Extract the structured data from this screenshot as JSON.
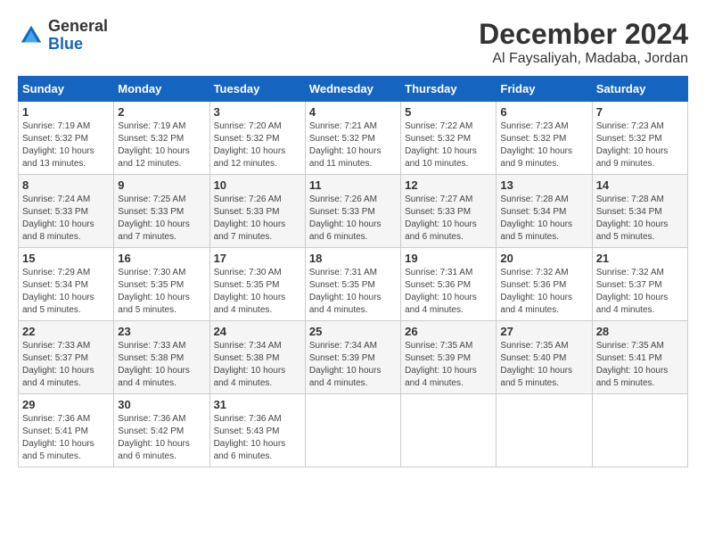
{
  "header": {
    "logo_general": "General",
    "logo_blue": "Blue",
    "month_title": "December 2024",
    "location": "Al Faysaliyah, Madaba, Jordan"
  },
  "days_of_week": [
    "Sunday",
    "Monday",
    "Tuesday",
    "Wednesday",
    "Thursday",
    "Friday",
    "Saturday"
  ],
  "weeks": [
    [
      {
        "day": "1",
        "info": "Sunrise: 7:19 AM\nSunset: 5:32 PM\nDaylight: 10 hours and 13 minutes."
      },
      {
        "day": "2",
        "info": "Sunrise: 7:19 AM\nSunset: 5:32 PM\nDaylight: 10 hours and 12 minutes."
      },
      {
        "day": "3",
        "info": "Sunrise: 7:20 AM\nSunset: 5:32 PM\nDaylight: 10 hours and 12 minutes."
      },
      {
        "day": "4",
        "info": "Sunrise: 7:21 AM\nSunset: 5:32 PM\nDaylight: 10 hours and 11 minutes."
      },
      {
        "day": "5",
        "info": "Sunrise: 7:22 AM\nSunset: 5:32 PM\nDaylight: 10 hours and 10 minutes."
      },
      {
        "day": "6",
        "info": "Sunrise: 7:23 AM\nSunset: 5:32 PM\nDaylight: 10 hours and 9 minutes."
      },
      {
        "day": "7",
        "info": "Sunrise: 7:23 AM\nSunset: 5:32 PM\nDaylight: 10 hours and 9 minutes."
      }
    ],
    [
      {
        "day": "8",
        "info": "Sunrise: 7:24 AM\nSunset: 5:33 PM\nDaylight: 10 hours and 8 minutes."
      },
      {
        "day": "9",
        "info": "Sunrise: 7:25 AM\nSunset: 5:33 PM\nDaylight: 10 hours and 7 minutes."
      },
      {
        "day": "10",
        "info": "Sunrise: 7:26 AM\nSunset: 5:33 PM\nDaylight: 10 hours and 7 minutes."
      },
      {
        "day": "11",
        "info": "Sunrise: 7:26 AM\nSunset: 5:33 PM\nDaylight: 10 hours and 6 minutes."
      },
      {
        "day": "12",
        "info": "Sunrise: 7:27 AM\nSunset: 5:33 PM\nDaylight: 10 hours and 6 minutes."
      },
      {
        "day": "13",
        "info": "Sunrise: 7:28 AM\nSunset: 5:34 PM\nDaylight: 10 hours and 5 minutes."
      },
      {
        "day": "14",
        "info": "Sunrise: 7:28 AM\nSunset: 5:34 PM\nDaylight: 10 hours and 5 minutes."
      }
    ],
    [
      {
        "day": "15",
        "info": "Sunrise: 7:29 AM\nSunset: 5:34 PM\nDaylight: 10 hours and 5 minutes."
      },
      {
        "day": "16",
        "info": "Sunrise: 7:30 AM\nSunset: 5:35 PM\nDaylight: 10 hours and 5 minutes."
      },
      {
        "day": "17",
        "info": "Sunrise: 7:30 AM\nSunset: 5:35 PM\nDaylight: 10 hours and 4 minutes."
      },
      {
        "day": "18",
        "info": "Sunrise: 7:31 AM\nSunset: 5:35 PM\nDaylight: 10 hours and 4 minutes."
      },
      {
        "day": "19",
        "info": "Sunrise: 7:31 AM\nSunset: 5:36 PM\nDaylight: 10 hours and 4 minutes."
      },
      {
        "day": "20",
        "info": "Sunrise: 7:32 AM\nSunset: 5:36 PM\nDaylight: 10 hours and 4 minutes."
      },
      {
        "day": "21",
        "info": "Sunrise: 7:32 AM\nSunset: 5:37 PM\nDaylight: 10 hours and 4 minutes."
      }
    ],
    [
      {
        "day": "22",
        "info": "Sunrise: 7:33 AM\nSunset: 5:37 PM\nDaylight: 10 hours and 4 minutes."
      },
      {
        "day": "23",
        "info": "Sunrise: 7:33 AM\nSunset: 5:38 PM\nDaylight: 10 hours and 4 minutes."
      },
      {
        "day": "24",
        "info": "Sunrise: 7:34 AM\nSunset: 5:38 PM\nDaylight: 10 hours and 4 minutes."
      },
      {
        "day": "25",
        "info": "Sunrise: 7:34 AM\nSunset: 5:39 PM\nDaylight: 10 hours and 4 minutes."
      },
      {
        "day": "26",
        "info": "Sunrise: 7:35 AM\nSunset: 5:39 PM\nDaylight: 10 hours and 4 minutes."
      },
      {
        "day": "27",
        "info": "Sunrise: 7:35 AM\nSunset: 5:40 PM\nDaylight: 10 hours and 5 minutes."
      },
      {
        "day": "28",
        "info": "Sunrise: 7:35 AM\nSunset: 5:41 PM\nDaylight: 10 hours and 5 minutes."
      }
    ],
    [
      {
        "day": "29",
        "info": "Sunrise: 7:36 AM\nSunset: 5:41 PM\nDaylight: 10 hours and 5 minutes."
      },
      {
        "day": "30",
        "info": "Sunrise: 7:36 AM\nSunset: 5:42 PM\nDaylight: 10 hours and 6 minutes."
      },
      {
        "day": "31",
        "info": "Sunrise: 7:36 AM\nSunset: 5:43 PM\nDaylight: 10 hours and 6 minutes."
      },
      null,
      null,
      null,
      null
    ]
  ]
}
